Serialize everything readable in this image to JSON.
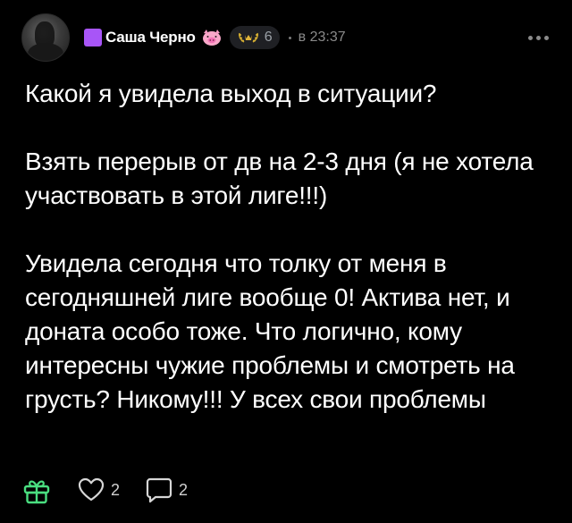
{
  "author": {
    "name": "Саша Черно",
    "level": "6",
    "time": "в 23:37",
    "badge_color": "#a855f7"
  },
  "post": {
    "paragraphs": [
      "Какой я увидела выход в ситуации?",
      "Взять перерыв от дв на 2-3 дня (я не хотела участвовать в этой лиге!!!)",
      "Увидела сегодня что толку от меня в сегодняшней лиге вообще 0! Актива нет, и доната особо тоже. Что логично, кому интересны чужие проблемы и смотреть на грусть? Никому!!! У всех свои проблемы"
    ]
  },
  "actions": {
    "likes_count": "2",
    "comments_count": "2"
  },
  "icons": {
    "avatar": "avatar",
    "pig": "pig-face-icon",
    "laurel": "laurel-wreath-icon",
    "more": "more-dots-icon",
    "gift": "gift-icon",
    "like": "heart-icon",
    "comment": "comment-bubble-icon"
  },
  "colors": {
    "background": "#000000",
    "text": "#ffffff",
    "muted": "#8a8a8a",
    "gift_green": "#4ade80"
  }
}
